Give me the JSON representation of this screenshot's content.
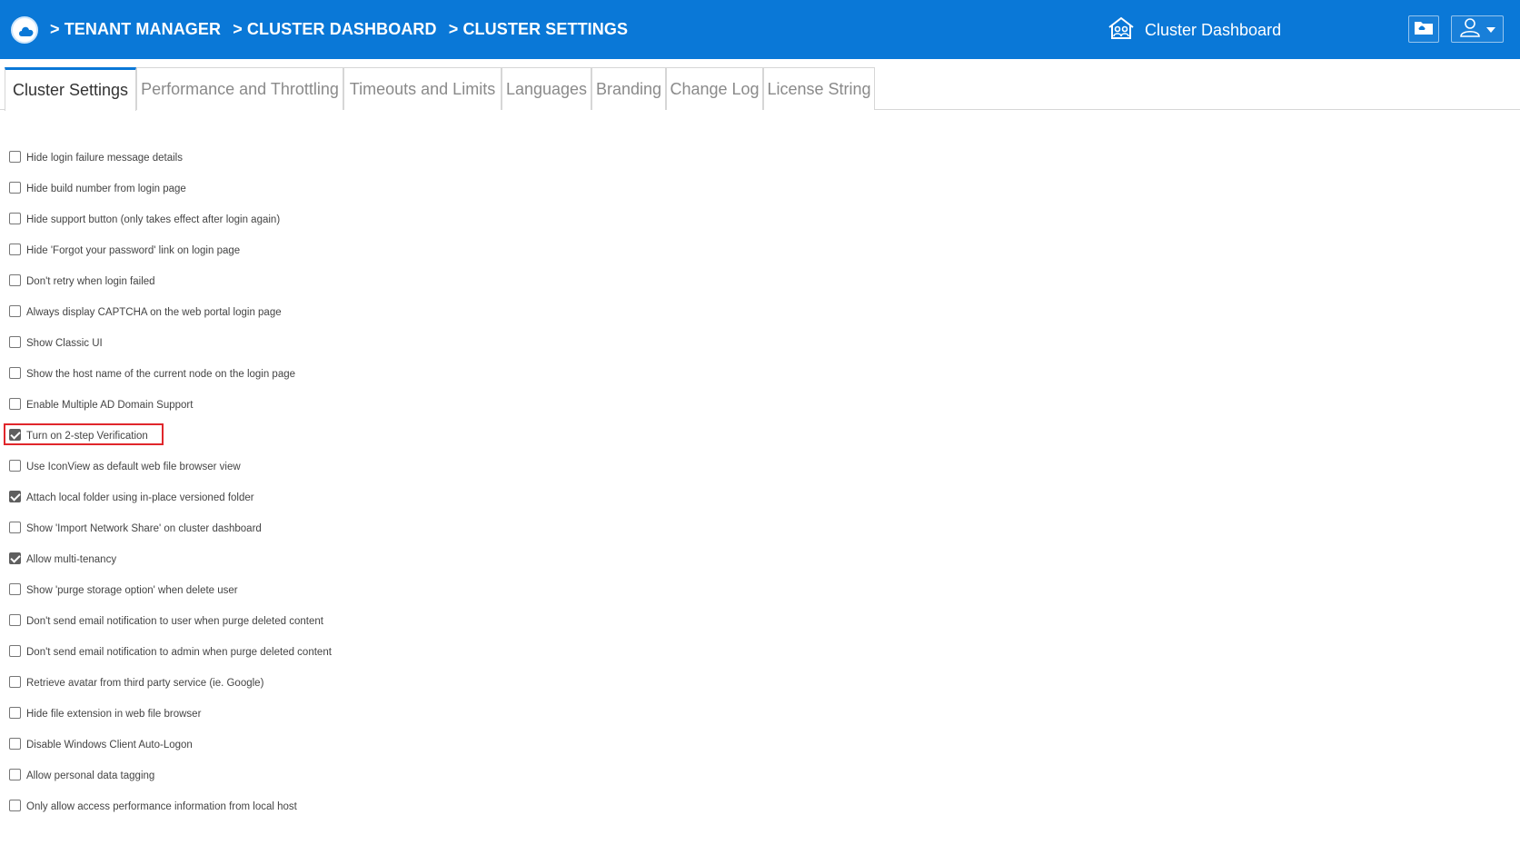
{
  "header": {
    "breadcrumb": [
      "> TENANT MANAGER",
      "> CLUSTER DASHBOARD",
      "> CLUSTER SETTINGS"
    ],
    "dashboard_link": "Cluster Dashboard",
    "accent_color": "#0a78d7",
    "icons": [
      "cloud-logo-icon",
      "house-users-icon",
      "folder-icon",
      "user-icon",
      "caret-down-icon"
    ]
  },
  "tabs": [
    {
      "label": "Cluster Settings",
      "active": true
    },
    {
      "label": "Performance and Throttling",
      "active": false
    },
    {
      "label": "Timeouts and Limits",
      "active": false
    },
    {
      "label": "Languages",
      "active": false
    },
    {
      "label": "Branding",
      "active": false
    },
    {
      "label": "Change Log",
      "active": false
    },
    {
      "label": "License String",
      "active": false
    }
  ],
  "settings": [
    {
      "label": "Hide login failure message details",
      "checked": false
    },
    {
      "label": "Hide build number from login page",
      "checked": false
    },
    {
      "label": "Hide support button (only takes effect after login again)",
      "checked": false
    },
    {
      "label": "Hide 'Forgot your password' link on login page",
      "checked": false
    },
    {
      "label": "Don't retry when login failed",
      "checked": false
    },
    {
      "label": "Always display CAPTCHA on the web portal login page",
      "checked": false
    },
    {
      "label": "Show Classic UI",
      "checked": false
    },
    {
      "label": "Show the host name of the current node on the login page",
      "checked": false
    },
    {
      "label": "Enable Multiple AD Domain Support",
      "checked": false
    },
    {
      "label": "Turn on 2-step Verification",
      "checked": true,
      "highlighted": true
    },
    {
      "label": "Use IconView as default web file browser view",
      "checked": false
    },
    {
      "label": "Attach local folder using in-place versioned folder",
      "checked": true
    },
    {
      "label": "Show 'Import Network Share' on cluster dashboard",
      "checked": false
    },
    {
      "label": "Allow multi-tenancy",
      "checked": true
    },
    {
      "label": "Show 'purge storage option' when delete user",
      "checked": false
    },
    {
      "label": "Don't send email notification to user when purge deleted content",
      "checked": false
    },
    {
      "label": "Don't send email notification to admin when purge deleted content",
      "checked": false
    },
    {
      "label": "Retrieve avatar from third party service (ie. Google)",
      "checked": false
    },
    {
      "label": "Hide file extension in web file browser",
      "checked": false
    },
    {
      "label": "Disable Windows Client Auto-Logon",
      "checked": false
    },
    {
      "label": "Allow personal data tagging",
      "checked": false
    },
    {
      "label": "Only allow access performance information from local host",
      "checked": false
    }
  ]
}
